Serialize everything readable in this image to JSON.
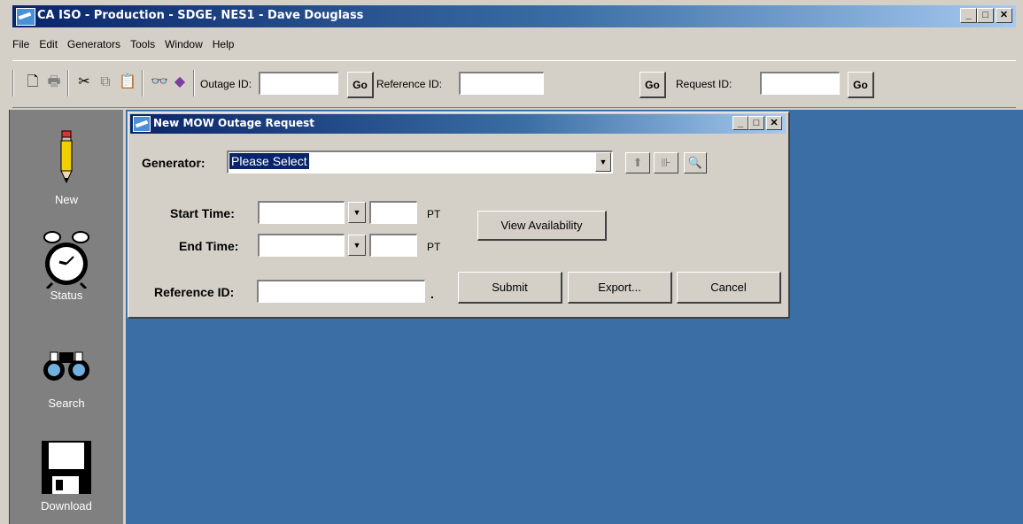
{
  "window": {
    "title": "CA ISO - Production - SDGE, NES1 - Dave Douglass"
  },
  "menu": {
    "items": [
      "File",
      "Edit",
      "Generators",
      "Tools",
      "Window",
      "Help"
    ]
  },
  "toolbar": {
    "outage_id_label": "Outage ID:",
    "outage_id_value": "",
    "reference_id_label": "Reference ID:",
    "reference_id_value": "",
    "request_id_label": "Request ID:",
    "request_id_value": "",
    "go_label": "Go",
    "icons": [
      "new-document-icon",
      "print-icon",
      "cut-icon",
      "copy-icon",
      "paste-icon",
      "find-icon",
      "book-icon"
    ]
  },
  "sidebar": {
    "items": [
      {
        "label": "New",
        "icon": "pencil-icon"
      },
      {
        "label": "Status",
        "icon": "alarm-clock-icon"
      },
      {
        "label": "Search",
        "icon": "binoculars-icon"
      },
      {
        "label": "Download",
        "icon": "floppy-disk-icon"
      }
    ]
  },
  "dialog": {
    "title": "New MOW Outage Request",
    "generator_label": "Generator:",
    "generator_value": "Please Select",
    "start_time_label": "Start Time:",
    "end_time_label": "End Time:",
    "timezone": "PT",
    "reference_id_label": "Reference ID:",
    "reference_suffix": ".",
    "view_availability_label": "View Availability",
    "submit_label": "Submit",
    "export_label": "Export...",
    "cancel_label": "Cancel"
  },
  "colors": {
    "titlebar": "#0a246a",
    "desktop": "#3a6ea5",
    "sidebar": "#808080",
    "chrome": "#d4d0c8"
  }
}
